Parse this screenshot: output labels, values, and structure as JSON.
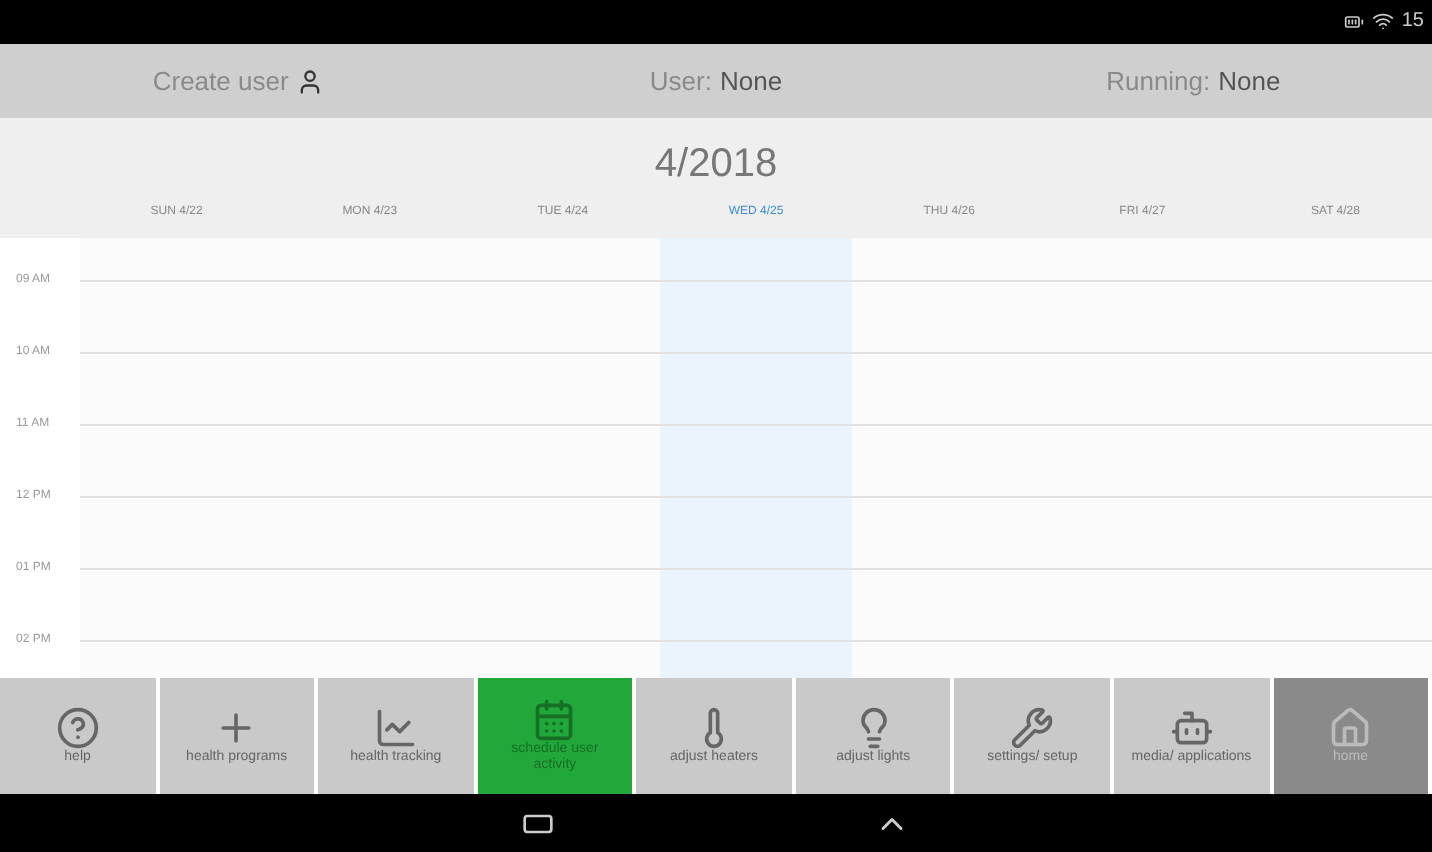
{
  "status_bar": {
    "time": "15"
  },
  "header": {
    "create_user": "Create user",
    "user_label": "User:",
    "user_value": "None",
    "running_label": "Running:",
    "running_value": "None"
  },
  "calendar": {
    "month": "4/2018",
    "days": [
      {
        "label": "SUN 4/22",
        "selected": false
      },
      {
        "label": "MON 4/23",
        "selected": false
      },
      {
        "label": "TUE 4/24",
        "selected": false
      },
      {
        "label": "WED 4/25",
        "selected": true
      },
      {
        "label": "THU 4/26",
        "selected": false
      },
      {
        "label": "FRI 4/27",
        "selected": false
      },
      {
        "label": "SAT 4/28",
        "selected": false
      }
    ],
    "times": [
      "09 AM",
      "10 AM",
      "11 AM",
      "12 PM",
      "01 PM",
      "02 PM"
    ]
  },
  "nav": [
    {
      "kind": "help",
      "label": "help",
      "selected": false
    },
    {
      "kind": "plus",
      "label": "health programs",
      "selected": false
    },
    {
      "kind": "chart",
      "label": "health tracking",
      "selected": false
    },
    {
      "kind": "calendar",
      "label": "schedule user activity",
      "selected": true
    },
    {
      "kind": "thermo",
      "label": "adjust heaters",
      "selected": false
    },
    {
      "kind": "bulb",
      "label": "adjust lights",
      "selected": false
    },
    {
      "kind": "tools",
      "label": "settings/ setup",
      "selected": false
    },
    {
      "kind": "robot",
      "label": "media/ applications",
      "selected": false
    },
    {
      "kind": "home",
      "label": "home",
      "selected": false
    }
  ]
}
